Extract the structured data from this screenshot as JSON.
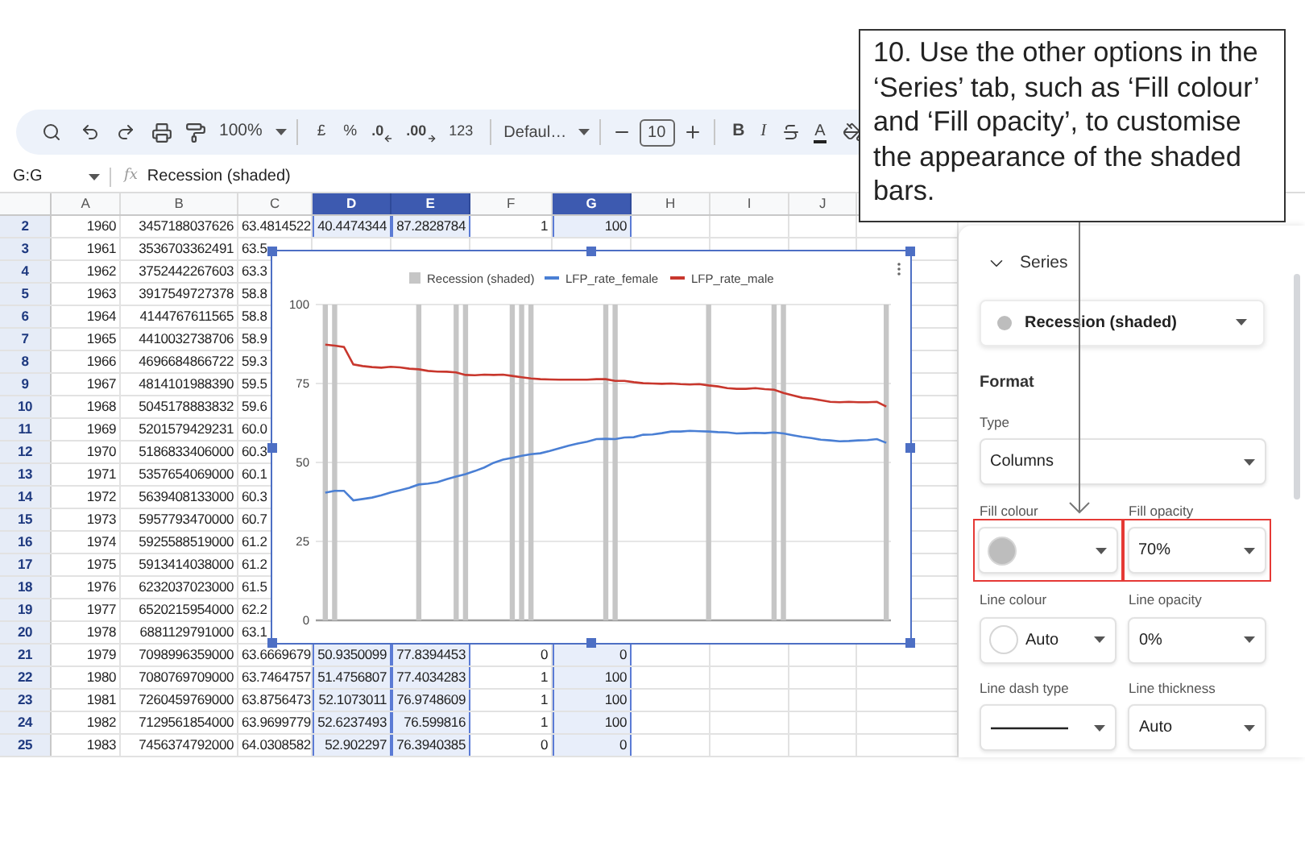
{
  "toolbar": {
    "zoom": "100%",
    "currency": "£",
    "percent": "%",
    "decrease_decimals": ".0",
    "increase_decimals": ".00",
    "number_format": "123",
    "font": "Defaul…",
    "font_size": "10",
    "bold": "B",
    "italic": "I",
    "text_color": "A"
  },
  "formula_bar": {
    "cell_range": "G:G",
    "function_label": "fx",
    "formula": "Recession (shaded)"
  },
  "columns": [
    {
      "label": "A",
      "selected": false
    },
    {
      "label": "B",
      "selected": false
    },
    {
      "label": "C",
      "selected": false
    },
    {
      "label": "D",
      "selected": true
    },
    {
      "label": "E",
      "selected": true
    },
    {
      "label": "F",
      "selected": false
    },
    {
      "label": "G",
      "selected": true
    },
    {
      "label": "H",
      "selected": false
    },
    {
      "label": "I",
      "selected": false
    },
    {
      "label": "J",
      "selected": false
    }
  ],
  "rows": [
    {
      "number": "2",
      "cells": [
        "1960",
        "3457188037626",
        "63.4814522",
        "40.4474344",
        "87.2828784",
        "1",
        "100"
      ]
    },
    {
      "number": "3",
      "cells": [
        "1961",
        "3536703362491",
        "63.5"
      ]
    },
    {
      "number": "4",
      "cells": [
        "1962",
        "3752442267603",
        "63.3"
      ]
    },
    {
      "number": "5",
      "cells": [
        "1963",
        "3917549727378",
        "58.8"
      ]
    },
    {
      "number": "6",
      "cells": [
        "1964",
        "4144767611565",
        "58.8"
      ]
    },
    {
      "number": "7",
      "cells": [
        "1965",
        "4410032738706",
        "58.9"
      ]
    },
    {
      "number": "8",
      "cells": [
        "1966",
        "4696684866722",
        "59.3"
      ]
    },
    {
      "number": "9",
      "cells": [
        "1967",
        "4814101988390",
        "59.5"
      ]
    },
    {
      "number": "10",
      "cells": [
        "1968",
        "5045178883832",
        "59.6"
      ]
    },
    {
      "number": "11",
      "cells": [
        "1969",
        "5201579429231",
        "60.0"
      ]
    },
    {
      "number": "12",
      "cells": [
        "1970",
        "5186833406000",
        "60.3"
      ]
    },
    {
      "number": "13",
      "cells": [
        "1971",
        "5357654069000",
        "60.1"
      ]
    },
    {
      "number": "14",
      "cells": [
        "1972",
        "5639408133000",
        "60.3"
      ]
    },
    {
      "number": "15",
      "cells": [
        "1973",
        "5957793470000",
        "60.7"
      ]
    },
    {
      "number": "16",
      "cells": [
        "1974",
        "5925588519000",
        "61.2"
      ]
    },
    {
      "number": "17",
      "cells": [
        "1975",
        "5913414038000",
        "61.2"
      ]
    },
    {
      "number": "18",
      "cells": [
        "1976",
        "6232037023000",
        "61.5"
      ]
    },
    {
      "number": "19",
      "cells": [
        "1977",
        "6520215954000",
        "62.2"
      ]
    },
    {
      "number": "20",
      "cells": [
        "1978",
        "6881129791000",
        "63.1"
      ]
    },
    {
      "number": "21",
      "cells": [
        "1979",
        "7098996359000",
        "63.6669679",
        "50.9350099",
        "77.8394453",
        "0",
        "0"
      ]
    },
    {
      "number": "22",
      "cells": [
        "1980",
        "7080769709000",
        "63.7464757",
        "51.4756807",
        "77.4034283",
        "1",
        "100"
      ]
    },
    {
      "number": "23",
      "cells": [
        "1981",
        "7260459769000",
        "63.8756473",
        "52.1073011",
        "76.9748609",
        "1",
        "100"
      ]
    },
    {
      "number": "24",
      "cells": [
        "1982",
        "7129561854000",
        "63.9699779",
        "52.6237493",
        "76.599816",
        "1",
        "100"
      ]
    },
    {
      "number": "25",
      "cells": [
        "1983",
        "7456374792000",
        "64.0308582",
        "52.902297",
        "76.3940385",
        "0",
        "0"
      ]
    }
  ],
  "chart": {
    "chart_data": {
      "type": "line",
      "grid": true,
      "legend": "top",
      "ylim": [
        0,
        100
      ],
      "yticks": [
        0,
        25,
        50,
        75,
        100
      ],
      "series": [
        {
          "name": "Recession (shaded)",
          "type": "bar",
          "color": "#c6c6c6",
          "values": [
            100,
            100,
            0,
            0,
            0,
            0,
            0,
            0,
            0,
            0,
            100,
            0,
            0,
            0,
            100,
            100,
            0,
            0,
            0,
            0,
            100,
            100,
            100,
            0,
            0,
            0,
            0,
            0,
            0,
            0,
            100,
            100,
            0,
            0,
            0,
            0,
            0,
            0,
            0,
            0,
            0,
            100,
            0,
            0,
            0,
            0,
            0,
            0,
            100,
            100,
            0,
            0,
            0,
            0,
            0,
            0,
            0,
            0,
            0,
            0,
            100
          ]
        },
        {
          "name": "LFP_rate_female",
          "color": "#4a7fd4",
          "values": [
            40.4,
            41.0,
            41.0,
            38.0,
            38.4,
            38.9,
            39.6,
            40.5,
            41.2,
            42.0,
            43.0,
            43.3,
            43.7,
            44.7,
            45.5,
            46.3,
            47.3,
            48.4,
            49.9,
            50.9,
            51.5,
            52.1,
            52.6,
            52.9,
            53.6,
            54.5,
            55.3,
            56.0,
            56.6,
            57.4,
            57.5,
            57.4,
            57.9,
            58.0,
            58.8,
            58.9,
            59.3,
            59.8,
            59.8,
            60.0,
            59.9,
            59.8,
            59.6,
            59.5,
            59.2,
            59.3,
            59.4,
            59.3,
            59.5,
            59.2,
            58.6,
            58.1,
            57.7,
            57.2,
            57.0,
            56.7,
            56.8,
            57.0,
            57.1,
            57.4,
            56.2
          ]
        },
        {
          "name": "LFP_rate_male",
          "color": "#c8372d",
          "values": [
            87.3,
            87.0,
            86.6,
            81.0,
            80.5,
            80.2,
            80.0,
            80.3,
            80.1,
            79.7,
            79.5,
            79.0,
            78.8,
            78.7,
            78.5,
            77.7,
            77.6,
            77.8,
            77.7,
            77.8,
            77.4,
            77.0,
            76.6,
            76.4,
            76.3,
            76.2,
            76.2,
            76.2,
            76.2,
            76.4,
            76.4,
            75.8,
            75.8,
            75.4,
            75.1,
            75.0,
            74.9,
            75.0,
            74.8,
            74.7,
            74.8,
            74.4,
            74.1,
            73.5,
            73.3,
            73.3,
            73.5,
            73.2,
            73.0,
            72.0,
            71.2,
            70.5,
            70.2,
            69.7,
            69.2,
            69.1,
            69.2,
            69.1,
            69.1,
            69.2,
            67.7
          ]
        }
      ]
    }
  },
  "panel": {
    "section": {
      "title": "Series",
      "expanded": true
    },
    "series_select": {
      "label": "Recession (shaded)",
      "color": "#bdbdbd"
    },
    "format_heading": "Format",
    "field_rows": [
      [
        {
          "label": "Type",
          "kind": "text",
          "value": "Columns",
          "highlighted": false
        }
      ],
      [
        {
          "label": "Fill colour",
          "kind": "swatch",
          "color": "#bdbdbd",
          "highlighted": true
        },
        {
          "label": "Fill opacity",
          "kind": "text",
          "value": "70%",
          "highlighted": true
        }
      ],
      [
        {
          "label": "Line colour",
          "kind": "swatch",
          "color": "#ffffff",
          "value": "Auto",
          "highlighted": false
        },
        {
          "label": "Line opacity",
          "kind": "text",
          "value": "0%",
          "highlighted": false
        }
      ],
      [
        {
          "label": "Line dash type",
          "kind": "dash",
          "highlighted": false
        },
        {
          "label": "Line thickness",
          "kind": "text",
          "value": "Auto",
          "highlighted": false
        }
      ]
    ]
  },
  "callout": {
    "text": "10. Use the other options in the ‘Series’ tab, such as ‘Fill colour’ and ‘Fill opacity’, to customise the appearance of the shaded bars."
  }
}
